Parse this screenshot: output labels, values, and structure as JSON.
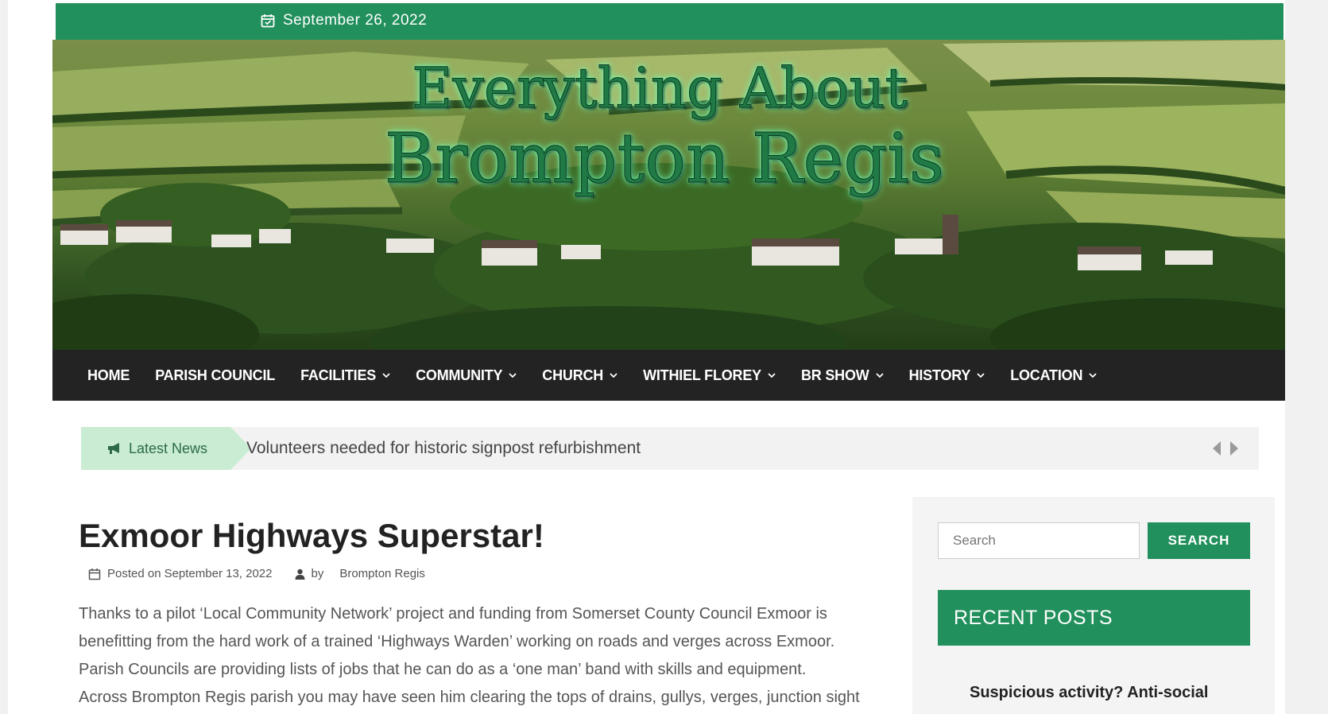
{
  "topbar": {
    "date": "September 26, 2022"
  },
  "header": {
    "title_line1": "Everything About",
    "title_line2": "Brompton Regis"
  },
  "nav": {
    "items": [
      {
        "label": "HOME",
        "dropdown": false
      },
      {
        "label": "PARISH COUNCIL",
        "dropdown": false
      },
      {
        "label": "FACILITIES",
        "dropdown": true
      },
      {
        "label": "COMMUNITY",
        "dropdown": true
      },
      {
        "label": "CHURCH",
        "dropdown": true
      },
      {
        "label": "WITHIEL FLOREY",
        "dropdown": true
      },
      {
        "label": "BR SHOW",
        "dropdown": true
      },
      {
        "label": "HISTORY",
        "dropdown": true
      },
      {
        "label": "LOCATION",
        "dropdown": true
      }
    ]
  },
  "ticker": {
    "tag": "Latest News",
    "headline": "Volunteers needed for historic signpost refurbishment"
  },
  "article": {
    "title": "Exmoor Highways Superstar!",
    "posted_prefix": "Posted on",
    "posted_date": "September 13, 2022",
    "by_label": "by",
    "author": "Brompton Regis",
    "body": [
      "Thanks to a pilot ‘Local Community Network’ project and funding from Somerset County Council Exmoor is",
      "benefitting from the hard work of a trained ‘Highways Warden’ working on roads and verges across Exmoor.",
      "Parish Councils are providing lists of jobs that he can  do as a ‘one man’ band with skills and equipment.",
      "Across Brompton Regis parish you may have seen him clearing the tops of drains, gullys, verges, junction sight"
    ]
  },
  "sidebar": {
    "search_placeholder": "Search",
    "search_button": "SEARCH",
    "recent_heading": "RECENT POSTS",
    "recent_posts": [
      "Suspicious activity? Anti-social"
    ]
  },
  "colors": {
    "brand_green": "#22905c",
    "nav_bg": "#232323",
    "ticker_tag_bg": "#c9ecd2"
  }
}
